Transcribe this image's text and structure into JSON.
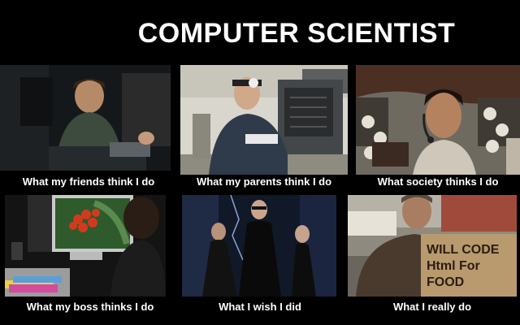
{
  "title": "COMPUTER SCIENTIST",
  "panels": [
    {
      "caption": "What my friends think I do"
    },
    {
      "caption": "What my parents think I do"
    },
    {
      "caption": "What society thinks I do"
    },
    {
      "caption": "What my boss thinks I do"
    },
    {
      "caption": "What I wish I did"
    },
    {
      "caption": "What I really do"
    }
  ],
  "sign_text": [
    "WILL CODE",
    "Html For",
    "FOOD"
  ]
}
